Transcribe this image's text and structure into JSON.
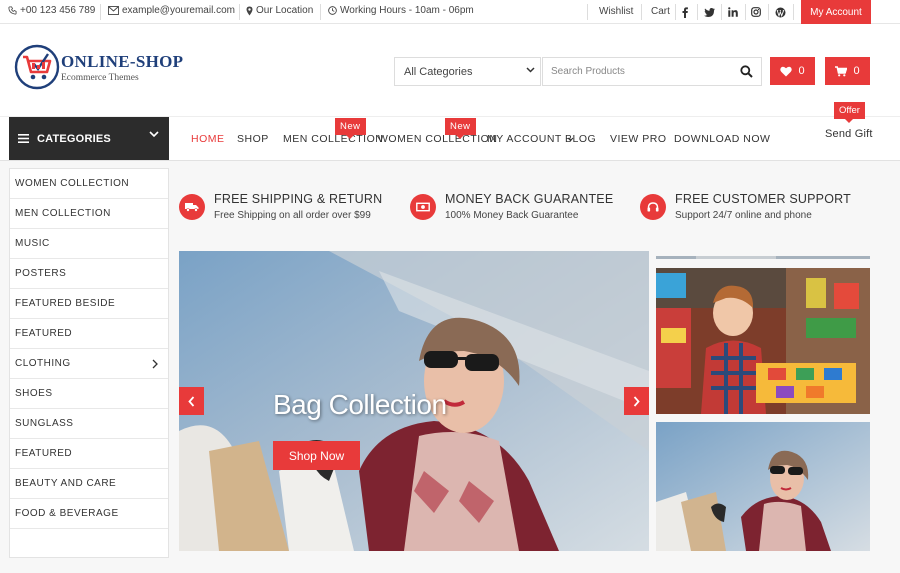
{
  "topbar": {
    "phone": "+00 123 456 789",
    "email": "example@youremail.com",
    "location": "Our Location",
    "hours": "Working Hours - 10am - 06pm",
    "wishlist": "Wishlist",
    "cart": "Cart",
    "my_account": "My Account",
    "social_icons": [
      "facebook-icon",
      "twitter-icon",
      "linkedin-icon",
      "instagram-icon",
      "wordpress-icon"
    ]
  },
  "logo": {
    "title": "ONLINE-SHOP",
    "subtitle": "Ecommerce Themes"
  },
  "search": {
    "category_selected": "All Categories",
    "placeholder": "Search Products"
  },
  "header_buttons": {
    "wishlist_count": "0",
    "cart_count": "0"
  },
  "nav": {
    "categories_label": "CATEGORIES",
    "items": [
      {
        "label": "HOME",
        "active": true
      },
      {
        "label": "SHOP"
      },
      {
        "label": "MEN COLLECTION",
        "tag": "New"
      },
      {
        "label": "WOMEN COLLECTION",
        "tag": "New"
      },
      {
        "label": "MY ACCOUNT"
      },
      {
        "label": "BLOG"
      },
      {
        "label": "VIEW PRO"
      },
      {
        "label": "DOWNLOAD NOW"
      }
    ],
    "send_gift": {
      "label": "Send Gift",
      "tag": "Offer"
    }
  },
  "sidebar": {
    "items": [
      "WOMEN COLLECTION",
      "MEN COLLECTION",
      "MUSIC",
      "POSTERS",
      "FEATURED BESIDE",
      "FEATURED",
      "CLOTHING",
      "SHOES",
      "SUNGLASS",
      "FEATURED",
      "BEAUTY AND CARE",
      "FOOD & BEVERAGE"
    ]
  },
  "features": [
    {
      "icon": "truck-icon",
      "title": "FREE SHIPPING & RETURN",
      "subtitle": "Free Shipping on all order over $99"
    },
    {
      "icon": "money-icon",
      "title": "MONEY BACK GUARANTEE",
      "subtitle": "100% Money Back Guarantee"
    },
    {
      "icon": "headset-icon",
      "title": "FREE CUSTOMER SUPPORT",
      "subtitle": "Support 24/7 online and phone"
    }
  ],
  "slider": {
    "title": "Bag Collection",
    "button": "Shop Now"
  },
  "colors": {
    "accent": "#e83a3a",
    "dark": "#2c2c2c",
    "logo_blue": "#1f3f7a"
  }
}
